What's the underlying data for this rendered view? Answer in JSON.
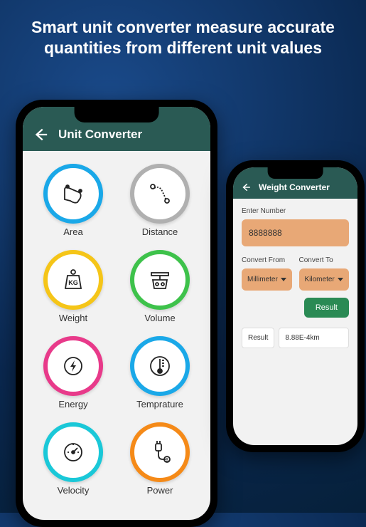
{
  "headline": "Smart unit converter measure accurate quantities from different unit values",
  "phone1": {
    "title": "Unit Converter",
    "categories": [
      {
        "label": "Area",
        "icon": "area-icon",
        "ring": "ring-blue"
      },
      {
        "label": "Distance",
        "icon": "distance-icon",
        "ring": "ring-gray"
      },
      {
        "label": "Weight",
        "icon": "weight-icon",
        "ring": "ring-yellow"
      },
      {
        "label": "Volume",
        "icon": "volume-icon",
        "ring": "ring-green"
      },
      {
        "label": "Energy",
        "icon": "energy-icon",
        "ring": "ring-pink"
      },
      {
        "label": "Temprature",
        "icon": "temperature-icon",
        "ring": "ring-blue"
      },
      {
        "label": "Velocity",
        "icon": "velocity-icon",
        "ring": "ring-cyan"
      },
      {
        "label": "Power",
        "icon": "power-icon",
        "ring": "ring-orange"
      }
    ]
  },
  "phone2": {
    "title": "Weight Converter",
    "enter_label": "Enter Number",
    "input_value": "8888888",
    "from_label": "Convert From",
    "to_label": "Convert To",
    "from_value": "Millimeter",
    "to_value": "Kilometer",
    "result_btn": "Result",
    "result_label": "Result",
    "result_value": "8.88E-4km"
  }
}
